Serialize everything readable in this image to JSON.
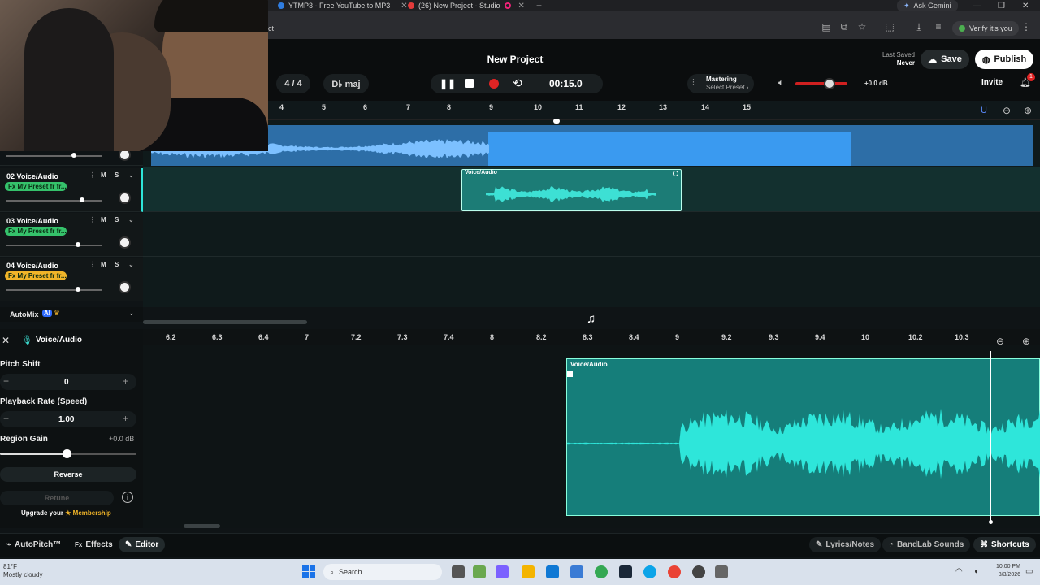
{
  "browser": {
    "tabs": [
      {
        "title": "YTMP3 - Free YouTube to MP3"
      },
      {
        "title": "(26) New Project - Studio"
      }
    ],
    "ask": "Ask Gemini",
    "verify": "Verify it's you",
    "url_fragment": "ct"
  },
  "app": {
    "project_title": "New Project",
    "time_signature": "4 / 4",
    "key": "D♭ maj",
    "time": "00:15.0",
    "mastering_title": "Mastering",
    "mastering_sub": "Select Preset",
    "volume_db": "+0.0 dB",
    "volume_level": 0.65,
    "last_saved_label": "Last Saved",
    "last_saved_value": "Never",
    "save": "Save",
    "publish": "Publish",
    "invite": "Invite",
    "notif_count": "1"
  },
  "ruler": [
    "4",
    "5",
    "6",
    "7",
    "8",
    "9",
    "10",
    "11",
    "12",
    "13",
    "14",
    "15"
  ],
  "tracks": [
    {
      "name": "02 Voice/Audio",
      "fx": "Fx My Preset fr fr...",
      "fx_color": "#35c26b",
      "m": "M",
      "s": "S"
    },
    {
      "name": "03 Voice/Audio",
      "fx": "Fx My Preset fr fr...",
      "fx_color": "#35c26b",
      "m": "M",
      "s": "S"
    },
    {
      "name": "04 Voice/Audio",
      "fx": "Fx My Preset fr fr...",
      "fx_color": "#f0b429",
      "m": "M",
      "s": "S"
    }
  ],
  "automix": {
    "label": "AutoMix",
    "badge": "AI"
  },
  "clip_title": "Voice/Audio",
  "editor": {
    "title": "Voice/Audio",
    "ruler": [
      "6.2",
      "6.3",
      "6.4",
      "7",
      "7.2",
      "7.3",
      "7.4",
      "8",
      "8.2",
      "8.3",
      "8.4",
      "9",
      "9.2",
      "9.3",
      "9.4",
      "10",
      "10.2",
      "10.3"
    ],
    "pitch_label": "Pitch Shift",
    "pitch_value": "0",
    "rate_label": "Playback Rate (Speed)",
    "rate_value": "1.00",
    "gain_label": "Region Gain",
    "gain_value": "+0.0 dB",
    "reverse": "Reverse",
    "retune": "Retune",
    "upgrade_prefix": "Upgrade your",
    "upgrade_link": "Membership",
    "clip_title": "Voice/Audio"
  },
  "footer": {
    "autopitch": "AutoPitch™",
    "effects": "Effects",
    "editor": "Editor",
    "lyrics": "Lyrics/Notes",
    "sounds": "BandLab Sounds",
    "shortcuts": "Shortcuts"
  },
  "taskbar": {
    "weather_temp": "81°F",
    "weather_desc": "Mostly cloudy",
    "search": "Search",
    "time": "10:00 PM",
    "date": "8/3/2026"
  }
}
